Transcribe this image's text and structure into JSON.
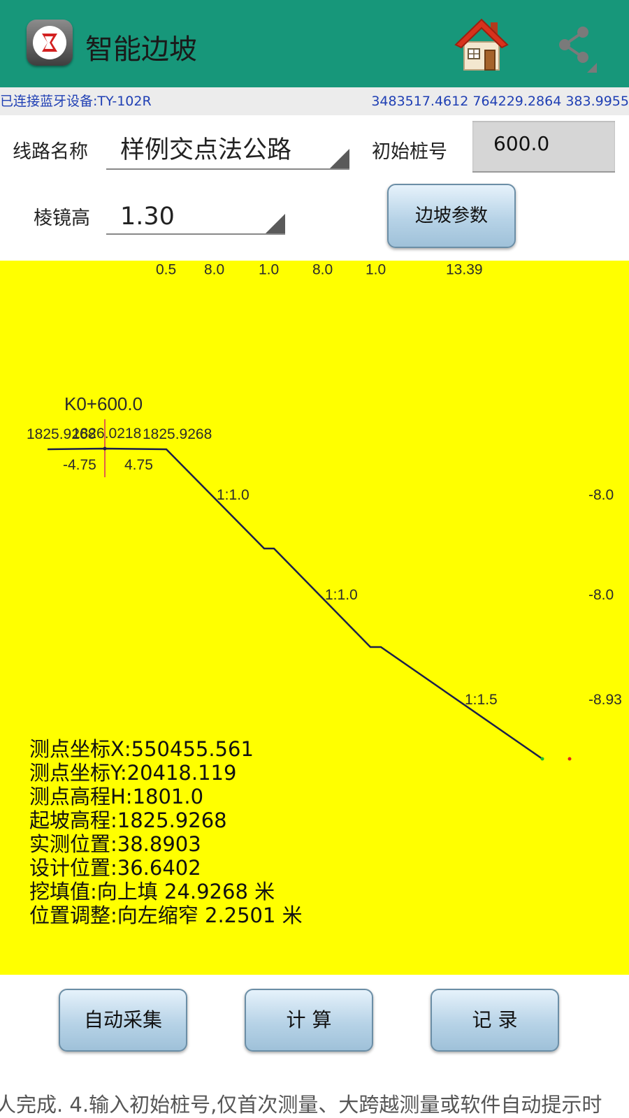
{
  "app": {
    "title": "智能边坡"
  },
  "status": {
    "bluetooth": "已连接蓝牙设备:TY-102R",
    "coords": "3483517.4612 764229.2864 383.9955"
  },
  "form": {
    "route_label": "线路名称",
    "route_value": "样例交点法公路",
    "stake_label": "初始桩号",
    "stake_value": "600.0",
    "prism_label": "棱镜高",
    "prism_value": "1.30",
    "slope_params_button": "边坡参数"
  },
  "canvas": {
    "top_dims": [
      "0.5",
      "8.0",
      "1.0",
      "8.0",
      "1.0",
      "13.39"
    ],
    "station": "K0+600.0",
    "elev_left": "1825.9268",
    "elev_center": "1826.0218",
    "elev_right": "1825.9268",
    "offset_left": "-4.75",
    "offset_right": "4.75",
    "slope_ratios": [
      "1:1.0",
      "1:1.0",
      "1:1.5"
    ],
    "right_heights": [
      "-8.0",
      "-8.0",
      "-8.93"
    ],
    "colors": {
      "background": "#ffff00",
      "profile": "#1b1f4a",
      "center_line": "#e0604a"
    }
  },
  "info": {
    "point_x": "测点坐标X:550455.561",
    "point_y": "测点坐标Y:20418.119",
    "point_h": "测点高程H:1801.0",
    "slope_start_elev": "起坡高程:1825.9268",
    "measured_pos": "实测位置:38.8903",
    "design_pos": "设计位置:36.6402",
    "cut_fill": "挖填值:向上填 24.9268 米",
    "pos_adjust": "位置调整:向左缩窄 2.2501 米"
  },
  "buttons": {
    "auto_collect": "自动采集",
    "compute": "计 算",
    "record": "记 录"
  },
  "ticker": "人完成.   4.输入初始桩号,仅首次测量、大跨越测量或软件自动提示时"
}
